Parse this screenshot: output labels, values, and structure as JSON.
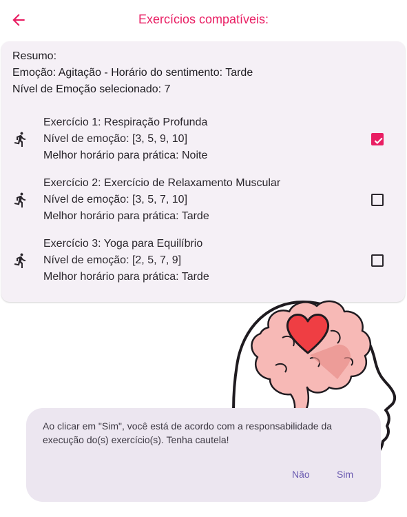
{
  "header": {
    "title": "Exercícios compatíveis:",
    "back_icon": "arrow-back-icon",
    "accent_color": "#e91e63"
  },
  "summary": {
    "heading": "Resumo:",
    "emotion_line": "Emoção: Agitação - Horário do sentimento: Tarde",
    "level_line": "Nível de Emoção selecionado: 7"
  },
  "exercises": [
    {
      "icon": "running-person-icon",
      "title": "Exercício 1: Respiração Profunda",
      "levels": "Nível de emoção: [3, 5, 9, 10]",
      "best_time": "Melhor horário para prática: Noite",
      "checked": true
    },
    {
      "icon": "running-person-icon",
      "title": "Exercício 2: Exercício de Relaxamento Muscular",
      "levels": "Nível de emoção: [3, 5, 7, 10]",
      "best_time": "Melhor horário para prática: Tarde",
      "checked": false
    },
    {
      "icon": "running-person-icon",
      "title": "Exercício 3: Yoga para Equilíbrio",
      "levels": "Nível de emoção: [2, 5, 7, 9]",
      "best_time": "Melhor horário para prática: Tarde",
      "checked": false
    }
  ],
  "illustration": {
    "name": "head-brain-heart-illustration"
  },
  "dialog": {
    "message": "Ao clicar em \"Sim\", você está de acordo com a responsabilidade da execução do(s) exercício(s). Tenha cautela!",
    "no_label": "Não",
    "yes_label": "Sim",
    "background": "#ece6f0"
  }
}
